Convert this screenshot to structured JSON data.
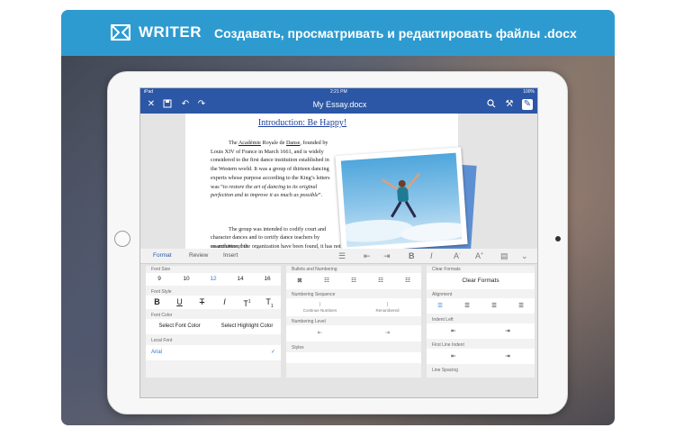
{
  "banner": {
    "logo_text": "WRITER",
    "tagline": "Создавать, просматривать и редактировать файлы .docx",
    "color": "#2e9bd0"
  },
  "status_bar": {
    "carrier": "iPad",
    "time": "2:21 PM",
    "battery": "100%"
  },
  "title_bar": {
    "title": "My Essay.docx",
    "color": "#2b57a6",
    "left_icons": [
      "close-icon",
      "save-icon",
      "undo-icon",
      "redo-icon"
    ],
    "right_icons": [
      "search-icon",
      "settings-icon",
      "edit-icon"
    ]
  },
  "document": {
    "heading": "Introduction: Be Happy!",
    "paragraph1_a": "The ",
    "paragraph1_link": "Académie",
    "paragraph1_b": " Royale de ",
    "paragraph1_link2": "Danse",
    "paragraph1_c": ", founded by Louis XIV of France in March 1661, and is widely considered to the first dance institution established in the Western world. It was a group of thirteen dancing experts whose purpose according to the King’s letters was “",
    "paragraph1_italic": "to restore the art of dancing to its original perfection and to improve it as much as possible",
    "paragraph1_d": "”.",
    "paragraph2": "The group was intended to codify court and character dances and to certify dance teachers by examination, but",
    "paragraph2_tail": "no archives of the organization have been found, it has not been possible to evaluate in detail its"
  },
  "ribbon": {
    "tabs": [
      "Format",
      "Review",
      "Insert"
    ],
    "active_tab": "Format"
  },
  "format_panel": {
    "font_size_label": "Font Size",
    "font_sizes": [
      "9",
      "10",
      "12",
      "14",
      "16"
    ],
    "selected_font_size": "12",
    "font_style_label": "Font Style",
    "font_color_label": "Font Color",
    "select_font_color": "Select Font Color",
    "select_highlight_color": "Select Highlight Color",
    "local_font_label": "Local Font",
    "local_font_value": "Arial"
  },
  "bullets_panel": {
    "bullets_label": "Bullets and Numbering",
    "numbering_sequence_label": "Numbering Sequence",
    "continue_numbers": "Continue Numbers",
    "renumbered": "Renumbered",
    "numbering_level_label": "Numbering Level",
    "styles_label": "Styles"
  },
  "right_panel": {
    "clear_formats_label": "Clear Formats",
    "clear_formats_button": "Clear Formats",
    "alignment_label": "Alignment",
    "indent_left_label": "Indent Left",
    "first_line_indent_label": "First Line Indent",
    "line_spacing_label": "Line Spacing"
  }
}
